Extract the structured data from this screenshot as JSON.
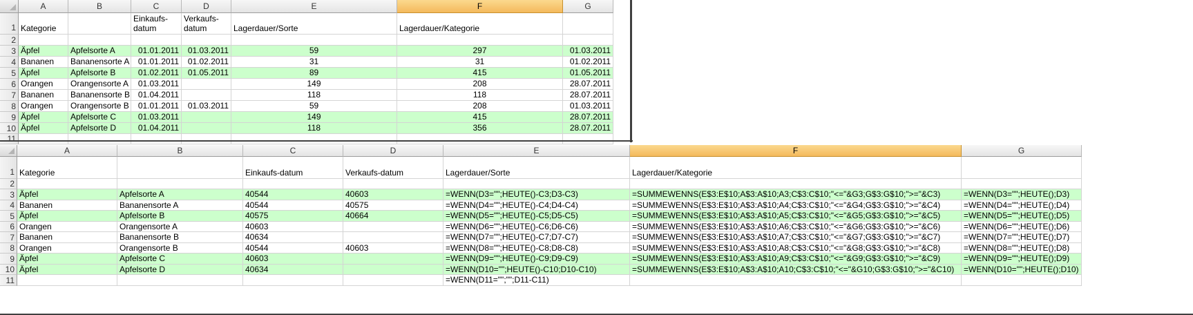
{
  "top": {
    "col_headers": [
      "A",
      "B",
      "C",
      "D",
      "E",
      "F",
      "G"
    ],
    "row_numbers": [
      "1",
      "2",
      "3",
      "4",
      "5",
      "6",
      "7",
      "8",
      "9",
      "10",
      "11"
    ],
    "headers": {
      "a": "Kategorie",
      "b": "",
      "c": "Einkaufs-datum",
      "d": "Verkaufs-datum",
      "e": "Lagerdauer/Sorte",
      "f": "Lagerdauer/Kategorie",
      "g": ""
    },
    "rows": [
      {
        "a": "Äpfel",
        "b": "Apfelsorte A",
        "c": "01.01.2011",
        "d": "01.03.2011",
        "e": "59",
        "f": "297",
        "g": "01.03.2011",
        "green": true
      },
      {
        "a": "Bananen",
        "b": "Bananensorte A",
        "c": "01.01.2011",
        "d": "01.02.2011",
        "e": "31",
        "f": "31",
        "g": "01.02.2011",
        "green": false
      },
      {
        "a": "Äpfel",
        "b": "Apfelsorte B",
        "c": "01.02.2011",
        "d": "01.05.2011",
        "e": "89",
        "f": "415",
        "g": "01.05.2011",
        "green": true
      },
      {
        "a": "Orangen",
        "b": "Orangensorte A",
        "c": "01.03.2011",
        "d": "",
        "e": "149",
        "f": "208",
        "g": "28.07.2011",
        "green": false
      },
      {
        "a": "Bananen",
        "b": "Bananensorte B",
        "c": "01.04.2011",
        "d": "",
        "e": "118",
        "f": "118",
        "g": "28.07.2011",
        "green": false
      },
      {
        "a": "Orangen",
        "b": "Orangensorte B",
        "c": "01.01.2011",
        "d": "01.03.2011",
        "e": "59",
        "f": "208",
        "g": "01.03.2011",
        "green": false
      },
      {
        "a": "Äpfel",
        "b": "Apfelsorte C",
        "c": "01.03.2011",
        "d": "",
        "e": "149",
        "f": "415",
        "g": "28.07.2011",
        "green": true
      },
      {
        "a": "Äpfel",
        "b": "Apfelsorte D",
        "c": "01.04.2011",
        "d": "",
        "e": "118",
        "f": "356",
        "g": "28.07.2011",
        "green": true
      }
    ]
  },
  "bottom": {
    "col_headers": [
      "A",
      "B",
      "C",
      "D",
      "E",
      "F",
      "G"
    ],
    "row_numbers": [
      "1",
      "2",
      "3",
      "4",
      "5",
      "6",
      "7",
      "8",
      "9",
      "10",
      "11"
    ],
    "headers": {
      "a": "Kategorie",
      "b": "",
      "c": "Einkaufs-datum",
      "d": "Verkaufs-datum",
      "e": "Lagerdauer/Sorte",
      "f": "Lagerdauer/Kategorie",
      "g": ""
    },
    "rows": [
      {
        "a": "Äpfel",
        "b": "Apfelsorte A",
        "c": "40544",
        "d": "40603",
        "e": "=WENN(D3=\"\";HEUTE()-C3;D3-C3)",
        "f": "=SUMMEWENNS(E$3:E$10;A$3:A$10;A3;C$3:C$10;\"<=\"&G3;G$3:G$10;\">=\"&C3)",
        "g": "=WENN(D3=\"\";HEUTE();D3)",
        "green": true
      },
      {
        "a": "Bananen",
        "b": "Bananensorte A",
        "c": "40544",
        "d": "40575",
        "e": "=WENN(D4=\"\";HEUTE()-C4;D4-C4)",
        "f": "=SUMMEWENNS(E$3:E$10;A$3:A$10;A4;C$3:C$10;\"<=\"&G4;G$3:G$10;\">=\"&C4)",
        "g": "=WENN(D4=\"\";HEUTE();D4)",
        "green": false
      },
      {
        "a": "Äpfel",
        "b": "Apfelsorte B",
        "c": "40575",
        "d": "40664",
        "e": "=WENN(D5=\"\";HEUTE()-C5;D5-C5)",
        "f": "=SUMMEWENNS(E$3:E$10;A$3:A$10;A5;C$3:C$10;\"<=\"&G5;G$3:G$10;\">=\"&C5)",
        "g": "=WENN(D5=\"\";HEUTE();D5)",
        "green": true
      },
      {
        "a": "Orangen",
        "b": "Orangensorte A",
        "c": "40603",
        "d": "",
        "e": "=WENN(D6=\"\";HEUTE()-C6;D6-C6)",
        "f": "=SUMMEWENNS(E$3:E$10;A$3:A$10;A6;C$3:C$10;\"<=\"&G6;G$3:G$10;\">=\"&C6)",
        "g": "=WENN(D6=\"\";HEUTE();D6)",
        "green": false
      },
      {
        "a": "Bananen",
        "b": "Bananensorte B",
        "c": "40634",
        "d": "",
        "e": "=WENN(D7=\"\";HEUTE()-C7;D7-C7)",
        "f": "=SUMMEWENNS(E$3:E$10;A$3:A$10;A7;C$3:C$10;\"<=\"&G7;G$3:G$10;\">=\"&C7)",
        "g": "=WENN(D7=\"\";HEUTE();D7)",
        "green": false
      },
      {
        "a": "Orangen",
        "b": "Orangensorte B",
        "c": "40544",
        "d": "40603",
        "e": "=WENN(D8=\"\";HEUTE()-C8;D8-C8)",
        "f": "=SUMMEWENNS(E$3:E$10;A$3:A$10;A8;C$3:C$10;\"<=\"&G8;G$3:G$10;\">=\"&C8)",
        "g": "=WENN(D8=\"\";HEUTE();D8)",
        "green": false
      },
      {
        "a": "Äpfel",
        "b": "Apfelsorte C",
        "c": "40603",
        "d": "",
        "e": "=WENN(D9=\"\";HEUTE()-C9;D9-C9)",
        "f": "=SUMMEWENNS(E$3:E$10;A$3:A$10;A9;C$3:C$10;\"<=\"&G9;G$3:G$10;\">=\"&C9)",
        "g": "=WENN(D9=\"\";HEUTE();D9)",
        "green": true
      },
      {
        "a": "Äpfel",
        "b": "Apfelsorte D",
        "c": "40634",
        "d": "",
        "e": "=WENN(D10=\"\";HEUTE()-C10;D10-C10)",
        "f": "=SUMMEWENNS(E$3:E$10;A$3:A$10;A10;C$3:C$10;\"<=\"&G10;G$3:G$10;\">=\"&C10)",
        "g": "=WENN(D10=\"\";HEUTE();D10)",
        "green": true
      }
    ],
    "row11_e": "=WENN(D11=\"\";\"\";D11-C11)"
  },
  "selected_column": "F",
  "colors": {
    "highlight_row": "#ccffcc",
    "selected_header": "#f4b95c",
    "gridline": "#d4d4d4"
  }
}
